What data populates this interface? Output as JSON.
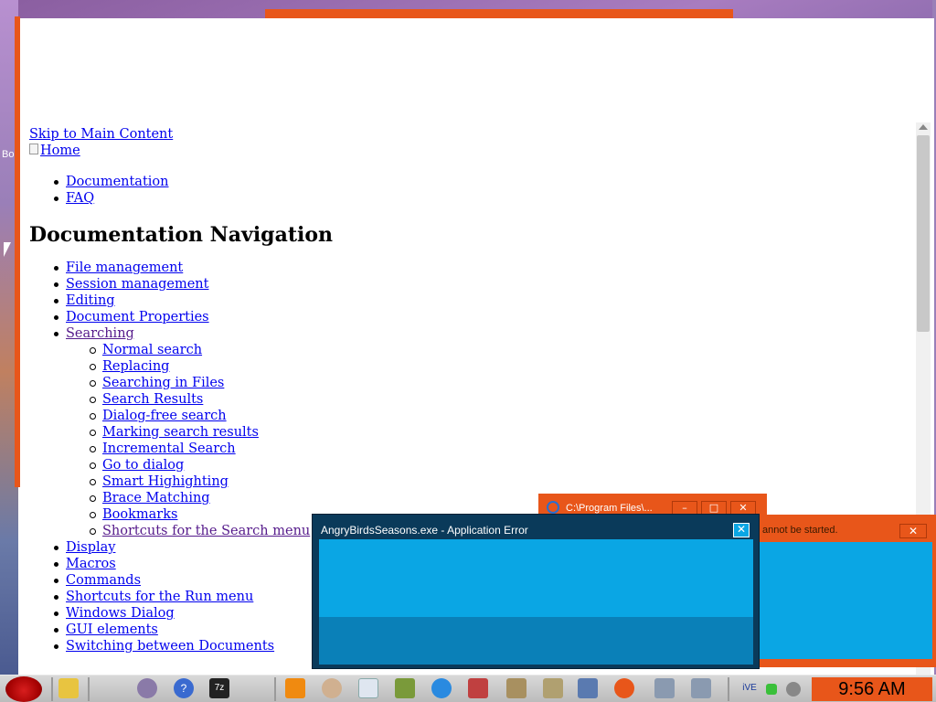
{
  "desktop": {
    "side_label": "Bo"
  },
  "browser": {
    "skip_link": "Skip to Main Content",
    "home_link": "Home",
    "top_nav": [
      "Documentation",
      "FAQ"
    ],
    "heading": "Documentation Navigation",
    "nav": {
      "items": [
        "File management",
        "Session management",
        "Editing",
        "Document Properties"
      ],
      "searching": {
        "label": "Searching",
        "children": [
          "Normal search",
          "Replacing",
          "Searching in Files",
          "Search Results",
          "Dialog-free search",
          "Marking search results",
          "Incremental Search",
          "Go to dialog",
          "Smart Highighting",
          "Brace Matching",
          "Bookmarks",
          "Shortcuts for the Search menu"
        ]
      },
      "items_after": [
        "Display",
        "Macros",
        "Commands",
        "Shortcuts for the Run menu",
        "Windows Dialog",
        "GUI elements",
        "Switching between Documents"
      ]
    }
  },
  "background_window_1": {
    "title": "C:\\Program Files\\...",
    "minimize": "–",
    "maximize": "□",
    "close": "✕"
  },
  "background_window_2": {
    "title": "annot be started.",
    "close": "✕"
  },
  "error_dialog": {
    "title": "AngryBirdsSeasons.exe - Application Error",
    "close": "✕"
  },
  "taskbar": {
    "clock": "9:56 AM",
    "icons": [
      "folder-icon",
      "app-icon",
      "help-icon",
      "7zip-icon",
      "vlc-icon",
      "paint-icon",
      "notepad-icon",
      "game-icon",
      "ie-icon",
      "tool-icon",
      "installer-icon",
      "archive-icon",
      "window-icon",
      "media-icon",
      "window2-icon",
      "window3-icon"
    ],
    "help_label": "?",
    "zip_label": "7z",
    "tray_text": "iVE"
  },
  "colors": {
    "accent_orange": "#e8561a",
    "dialog_blue": "#0aa6e4",
    "link_blue": "#0000ee",
    "link_visited": "#551a8b"
  }
}
